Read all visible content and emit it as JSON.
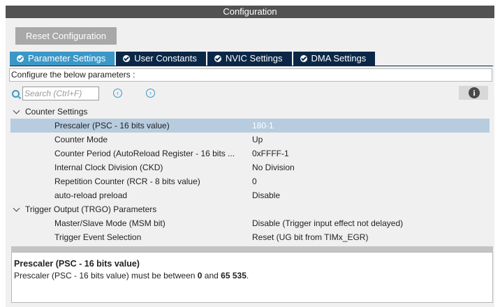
{
  "window": {
    "title": "Configuration"
  },
  "reset_button": {
    "label": "Reset Configuration"
  },
  "tabs": [
    {
      "label": "Parameter Settings",
      "active": true
    },
    {
      "label": "User Constants",
      "active": false
    },
    {
      "label": "NVIC Settings",
      "active": false
    },
    {
      "label": "DMA Settings",
      "active": false
    }
  ],
  "hint": "Configure the below parameters :",
  "search": {
    "placeholder": "Search (Ctrl+F)",
    "value": ""
  },
  "icons": {
    "search": "search-icon",
    "prev": "chevron-left-circle-icon",
    "next": "chevron-right-circle-icon",
    "info": "info-icon",
    "prev_glyph": "‹",
    "next_glyph": "›",
    "info_glyph": "i"
  },
  "groups": [
    {
      "label": "Counter Settings",
      "params": [
        {
          "name": "Prescaler (PSC - 16 bits value)",
          "value": "180-1",
          "selected": true
        },
        {
          "name": "Counter Mode",
          "value": "Up"
        },
        {
          "name": "Counter Period (AutoReload Register - 16 bits ...",
          "value": "0xFFFF-1"
        },
        {
          "name": "Internal Clock Division (CKD)",
          "value": "No Division"
        },
        {
          "name": "Repetition Counter (RCR - 8 bits value)",
          "value": "0"
        },
        {
          "name": "auto-reload preload",
          "value": "Disable"
        }
      ]
    },
    {
      "label": "Trigger Output (TRGO) Parameters",
      "params": [
        {
          "name": "Master/Slave Mode (MSM bit)",
          "value": "Disable (Trigger input effect not delayed)"
        },
        {
          "name": "Trigger Event Selection",
          "value": "Reset (UG bit from TIMx_EGR)"
        }
      ]
    }
  ],
  "description": {
    "title": "Prescaler (PSC - 16 bits value)",
    "text_prefix": "Prescaler (PSC - 16 bits value) must be between ",
    "min": "0",
    "text_mid": " and ",
    "max": "65 535",
    "text_suffix": "."
  },
  "colors": {
    "tab_active": "#3b97c8",
    "tab_inactive": "#0b2748",
    "selection": "#b8ccdf",
    "title_bar": "#525252"
  }
}
